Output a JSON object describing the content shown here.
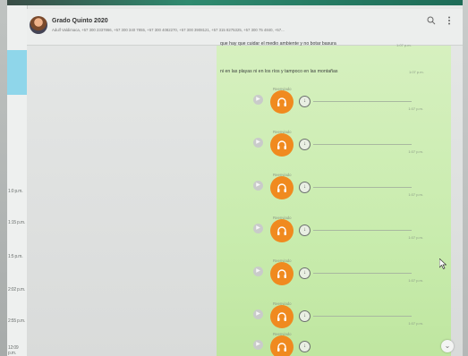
{
  "header": {
    "title": "Grado Quinto 2020",
    "participants": "Adulf Valdimaca, +57 300 2337866, +57 300 340 7855, +57 300 4082270, +57 300 3908121, +57 315 8275325, +57 300 75 4840, +57..."
  },
  "left_panel": {
    "times": [
      "1:0 p.m.",
      "1:15 p.m.",
      "1:5 p.m.",
      "2:02 p.m.",
      "2:55 p.m.",
      "12:09 p.m."
    ]
  },
  "messages": [
    {
      "text": "que hay que cuidar el medio ambiente y no botar basura",
      "time": "1:07 p.m."
    },
    {
      "text": "ni en las playas ni en los ríos y tampoco en las montañas",
      "time": "1:07 p.m."
    }
  ],
  "audios": [
    {
      "forwarded": "Reenviado",
      "time": "1:07 p.m."
    },
    {
      "forwarded": "Reenviado",
      "time": "1:07 p.m."
    },
    {
      "forwarded": "Reenviado",
      "time": "1:07 p.m."
    },
    {
      "forwarded": "Reenviado",
      "time": "1:07 p.m."
    },
    {
      "forwarded": "Reenviado",
      "time": "1:07 p.m."
    },
    {
      "forwarded": "Reenviado",
      "time": "1:07 p.m."
    },
    {
      "forwarded": "Reenviado",
      "time": "1:07 p.m."
    }
  ],
  "icons": {
    "search": "search-icon",
    "menu": "more-vertical-icon",
    "play": "play-icon",
    "headphones": "headphones-icon",
    "download": "download-icon",
    "scroll_down": "chevron-down-icon"
  },
  "colors": {
    "outgoing_bubble": "#c9ecae",
    "audio_avatar": "#f08a1f",
    "left_selected": "#8fd6ea"
  }
}
